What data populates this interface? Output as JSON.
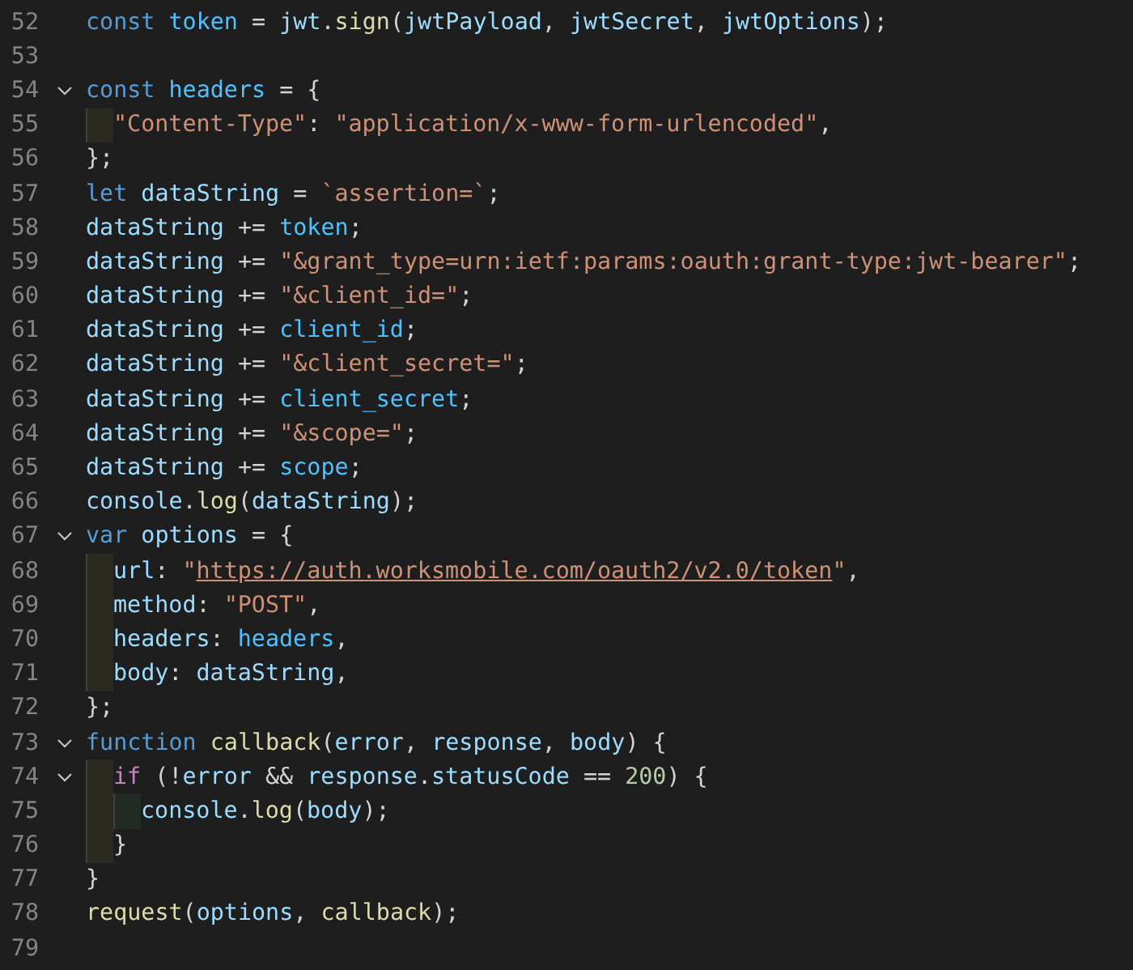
{
  "editor": {
    "lines": [
      {
        "number": "52",
        "tokens": [
          {
            "text": "const ",
            "kind": "keyword"
          },
          {
            "text": "token",
            "kind": "constant"
          },
          {
            "text": " = ",
            "kind": "plain"
          },
          {
            "text": "jwt",
            "kind": "variable"
          },
          {
            "text": ".",
            "kind": "plain"
          },
          {
            "text": "sign",
            "kind": "function"
          },
          {
            "text": "(",
            "kind": "plain"
          },
          {
            "text": "jwtPayload",
            "kind": "variable"
          },
          {
            "text": ", ",
            "kind": "plain"
          },
          {
            "text": "jwtSecret",
            "kind": "variable"
          },
          {
            "text": ", ",
            "kind": "plain"
          },
          {
            "text": "jwtOptions",
            "kind": "variable"
          },
          {
            "text": ");",
            "kind": "plain"
          }
        ]
      },
      {
        "number": "53"
      },
      {
        "number": "54",
        "expanded": true,
        "tokens": [
          {
            "text": "const ",
            "kind": "keyword"
          },
          {
            "text": "headers",
            "kind": "constant"
          },
          {
            "text": " = {",
            "kind": "plain"
          }
        ],
        "children": [
          {
            "number": "55",
            "tokens": [
              {
                "text": "\"Content-Type\"",
                "kind": "string"
              },
              {
                "text": ": ",
                "kind": "plain"
              },
              {
                "text": "\"application/x-www-form-urlencoded\"",
                "kind": "string"
              },
              {
                "text": ",",
                "kind": "plain"
              }
            ]
          }
        ]
      },
      {
        "number": "56",
        "tokens": [
          {
            "text": "};",
            "kind": "plain"
          }
        ]
      },
      {
        "number": "57",
        "tokens": [
          {
            "text": "let ",
            "kind": "keyword"
          },
          {
            "text": "dataString",
            "kind": "variable"
          },
          {
            "text": " = ",
            "kind": "plain"
          },
          {
            "text": "`assertion=`",
            "kind": "string"
          },
          {
            "text": ";",
            "kind": "plain"
          }
        ]
      },
      {
        "number": "58",
        "tokens": [
          {
            "text": "dataString",
            "kind": "variable"
          },
          {
            "text": " += ",
            "kind": "plain"
          },
          {
            "text": "token",
            "kind": "constant"
          },
          {
            "text": ";",
            "kind": "plain"
          }
        ]
      },
      {
        "number": "59",
        "tokens": [
          {
            "text": "dataString",
            "kind": "variable"
          },
          {
            "text": " += ",
            "kind": "plain"
          },
          {
            "text": "\"&grant_type=urn:ietf:params:oauth:grant-type:jwt-bearer\"",
            "kind": "string"
          },
          {
            "text": ";",
            "kind": "plain"
          }
        ]
      },
      {
        "number": "60",
        "tokens": [
          {
            "text": "dataString",
            "kind": "variable"
          },
          {
            "text": " += ",
            "kind": "plain"
          },
          {
            "text": "\"&client_id=\"",
            "kind": "string"
          },
          {
            "text": ";",
            "kind": "plain"
          }
        ]
      },
      {
        "number": "61",
        "tokens": [
          {
            "text": "dataString",
            "kind": "variable"
          },
          {
            "text": " += ",
            "kind": "plain"
          },
          {
            "text": "client_id",
            "kind": "constant"
          },
          {
            "text": ";",
            "kind": "plain"
          }
        ]
      },
      {
        "number": "62",
        "tokens": [
          {
            "text": "dataString",
            "kind": "variable"
          },
          {
            "text": " += ",
            "kind": "plain"
          },
          {
            "text": "\"&client_secret=\"",
            "kind": "string"
          },
          {
            "text": ";",
            "kind": "plain"
          }
        ]
      },
      {
        "number": "63",
        "tokens": [
          {
            "text": "dataString",
            "kind": "variable"
          },
          {
            "text": " += ",
            "kind": "plain"
          },
          {
            "text": "client_secret",
            "kind": "constant"
          },
          {
            "text": ";",
            "kind": "plain"
          }
        ]
      },
      {
        "number": "64",
        "tokens": [
          {
            "text": "dataString",
            "kind": "variable"
          },
          {
            "text": " += ",
            "kind": "plain"
          },
          {
            "text": "\"&scope=\"",
            "kind": "string"
          },
          {
            "text": ";",
            "kind": "plain"
          }
        ]
      },
      {
        "number": "65",
        "tokens": [
          {
            "text": "dataString",
            "kind": "variable"
          },
          {
            "text": " += ",
            "kind": "plain"
          },
          {
            "text": "scope",
            "kind": "constant"
          },
          {
            "text": ";",
            "kind": "plain"
          }
        ]
      },
      {
        "number": "66",
        "tokens": [
          {
            "text": "console",
            "kind": "variable"
          },
          {
            "text": ".",
            "kind": "plain"
          },
          {
            "text": "log",
            "kind": "function"
          },
          {
            "text": "(",
            "kind": "plain"
          },
          {
            "text": "dataString",
            "kind": "variable"
          },
          {
            "text": ");",
            "kind": "plain"
          }
        ]
      },
      {
        "number": "67",
        "expanded": true,
        "tokens": [
          {
            "text": "var ",
            "kind": "keyword"
          },
          {
            "text": "options",
            "kind": "variable"
          },
          {
            "text": " = {",
            "kind": "plain"
          }
        ],
        "children": [
          {
            "number": "68",
            "tokens": [
              {
                "text": "url",
                "kind": "variable"
              },
              {
                "text": ": ",
                "kind": "plain"
              },
              {
                "text": "\"",
                "kind": "string"
              },
              {
                "text": "https://auth.worksmobile.com/oauth2/v2.0/token",
                "kind": "link"
              },
              {
                "text": "\"",
                "kind": "string"
              },
              {
                "text": ",",
                "kind": "plain"
              }
            ]
          },
          {
            "number": "69",
            "tokens": [
              {
                "text": "method",
                "kind": "variable"
              },
              {
                "text": ": ",
                "kind": "plain"
              },
              {
                "text": "\"POST\"",
                "kind": "string"
              },
              {
                "text": ",",
                "kind": "plain"
              }
            ]
          },
          {
            "number": "70",
            "tokens": [
              {
                "text": "headers",
                "kind": "variable"
              },
              {
                "text": ": ",
                "kind": "plain"
              },
              {
                "text": "headers",
                "kind": "constant"
              },
              {
                "text": ",",
                "kind": "plain"
              }
            ]
          },
          {
            "number": "71",
            "tokens": [
              {
                "text": "body",
                "kind": "variable"
              },
              {
                "text": ": ",
                "kind": "plain"
              },
              {
                "text": "dataString",
                "kind": "variable"
              },
              {
                "text": ",",
                "kind": "plain"
              }
            ]
          }
        ]
      },
      {
        "number": "72",
        "tokens": [
          {
            "text": "};",
            "kind": "plain"
          }
        ]
      },
      {
        "number": "73",
        "expanded": true,
        "tokens": [
          {
            "text": "function ",
            "kind": "keyword"
          },
          {
            "text": "callback",
            "kind": "function"
          },
          {
            "text": "(",
            "kind": "plain"
          },
          {
            "text": "error",
            "kind": "variable"
          },
          {
            "text": ", ",
            "kind": "plain"
          },
          {
            "text": "response",
            "kind": "variable"
          },
          {
            "text": ", ",
            "kind": "plain"
          },
          {
            "text": "body",
            "kind": "variable"
          },
          {
            "text": ") {",
            "kind": "plain"
          }
        ],
        "children": [
          {
            "number": "74",
            "expanded": true,
            "tokens": [
              {
                "text": "if",
                "kind": "control"
              },
              {
                "text": " (!",
                "kind": "plain"
              },
              {
                "text": "error",
                "kind": "variable"
              },
              {
                "text": " && ",
                "kind": "plain"
              },
              {
                "text": "response",
                "kind": "variable"
              },
              {
                "text": ".",
                "kind": "plain"
              },
              {
                "text": "statusCode",
                "kind": "variable"
              },
              {
                "text": " == ",
                "kind": "plain"
              },
              {
                "text": "200",
                "kind": "number"
              },
              {
                "text": ") {",
                "kind": "plain"
              }
            ],
            "children": [
              {
                "number": "75",
                "tokens": [
                  {
                    "text": "console",
                    "kind": "variable"
                  },
                  {
                    "text": ".",
                    "kind": "plain"
                  },
                  {
                    "text": "log",
                    "kind": "function"
                  },
                  {
                    "text": "(",
                    "kind": "plain"
                  },
                  {
                    "text": "body",
                    "kind": "variable"
                  },
                  {
                    "text": ");",
                    "kind": "plain"
                  }
                ]
              }
            ]
          },
          {
            "number": "76",
            "tokens": [
              {
                "text": "}",
                "kind": "plain"
              }
            ]
          }
        ]
      },
      {
        "number": "77",
        "tokens": [
          {
            "text": "}",
            "kind": "plain"
          }
        ]
      },
      {
        "number": "78",
        "tokens": [
          {
            "text": "request",
            "kind": "function"
          },
          {
            "text": "(",
            "kind": "plain"
          },
          {
            "text": "options",
            "kind": "variable"
          },
          {
            "text": ", ",
            "kind": "plain"
          },
          {
            "text": "callback",
            "kind": "function"
          },
          {
            "text": ");",
            "kind": "plain"
          }
        ]
      },
      {
        "number": "79"
      }
    ]
  }
}
